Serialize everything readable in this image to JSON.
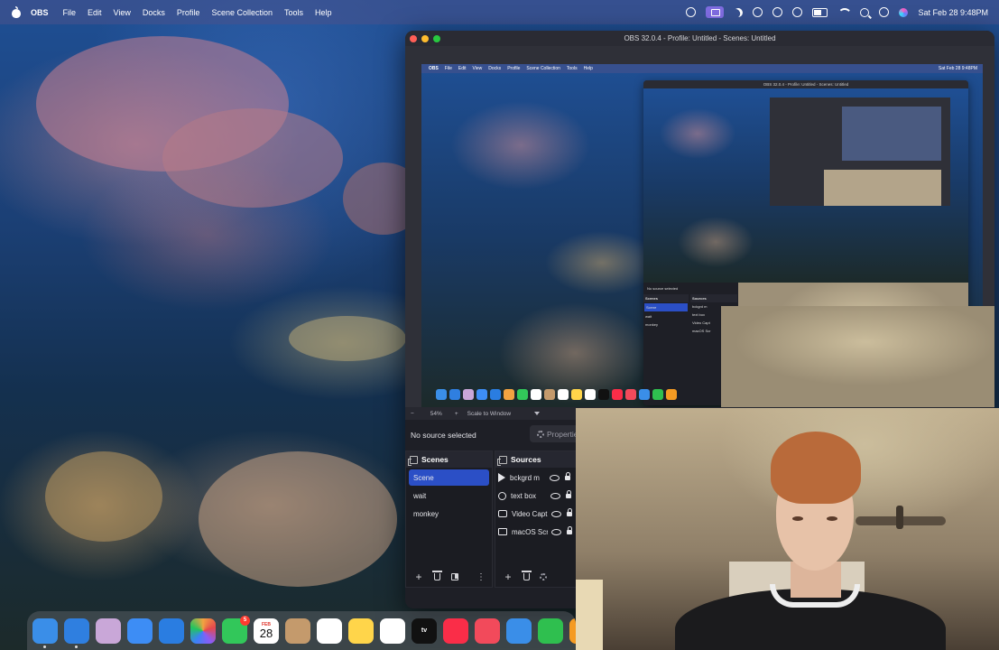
{
  "menubar": {
    "app_name": "OBS",
    "items": [
      "File",
      "Edit",
      "View",
      "Docks",
      "Profile",
      "Scene Collection",
      "Tools",
      "Help"
    ],
    "datetime": "Sat Feb 28  9:48PM"
  },
  "obs_window": {
    "title": "OBS 32.0.4 - Profile: Untitled - Scenes: Untitled",
    "toolbar": {
      "zoom_minus": "−",
      "zoom": "54%",
      "zoom_plus": "+",
      "scale_mode": "Scale to Window"
    },
    "properties_bar": {
      "no_source": "No source selected",
      "properties_button": "Properties"
    },
    "scenes": {
      "header": "Scenes",
      "items": [
        "Scene",
        "wait",
        "monkey"
      ],
      "active_index": 0
    },
    "sources": {
      "header": "Sources",
      "items": [
        {
          "label": "bckgrd m",
          "icon": "play-icon"
        },
        {
          "label": "text box",
          "icon": "text-icon"
        },
        {
          "label": "Video Capt",
          "icon": "camera-icon"
        },
        {
          "label": "macOS Scr",
          "icon": "screen-icon"
        }
      ]
    },
    "footer": {
      "add": "+",
      "more": "⋮"
    }
  },
  "nested_preview": {
    "title": "OBS 32.0.4 - Profile: Untitled - Scenes: Untitled",
    "inner_menu": [
      "OBS",
      "File",
      "Edit",
      "View",
      "Docks",
      "Profile",
      "Scene Collection",
      "Tools",
      "Help"
    ],
    "inner_datetime": "Sat Feb 28  9:48PM",
    "no_source": "No source selected",
    "scenes": [
      "Scenes",
      "Scene",
      "wait",
      "monkey"
    ],
    "sources": [
      "Sources",
      "bckgrd m",
      "text box",
      "Video Capt",
      "macOS Scr"
    ]
  },
  "dock": {
    "calendar": {
      "month": "FEB",
      "day": "28"
    },
    "facetime_badge": "5",
    "tv_label": "tv",
    "apps": [
      {
        "name": "finder-icon",
        "color": "#3a8ee8"
      },
      {
        "name": "safari-icon",
        "color": "#2f7fe0"
      },
      {
        "name": "launchpad-icon",
        "color": "#c9a7d8"
      },
      {
        "name": "mail-icon",
        "color": "#3d8df5"
      },
      {
        "name": "appstore-icon",
        "color": "#2a7de1"
      },
      {
        "name": "photos-icon",
        "color": "#f2a341"
      },
      {
        "name": "facetime-icon",
        "color": "#32c75a"
      },
      {
        "name": "calendar-icon",
        "color": "#ffffff"
      },
      {
        "name": "contacts-icon",
        "color": "#c49a6c"
      },
      {
        "name": "reminders-icon",
        "color": "#ffffff"
      },
      {
        "name": "notes-icon",
        "color": "#ffd54a"
      },
      {
        "name": "freeform-icon",
        "color": "#ffffff"
      },
      {
        "name": "tv-icon",
        "color": "#111111"
      },
      {
        "name": "music-icon",
        "color": "#fa2d48"
      },
      {
        "name": "news-icon",
        "color": "#f24a5b"
      },
      {
        "name": "keynote-icon",
        "color": "#3a8ee8"
      },
      {
        "name": "numbers-icon",
        "color": "#2fbf4f"
      },
      {
        "name": "pages-icon",
        "color": "#f59b23"
      }
    ]
  }
}
